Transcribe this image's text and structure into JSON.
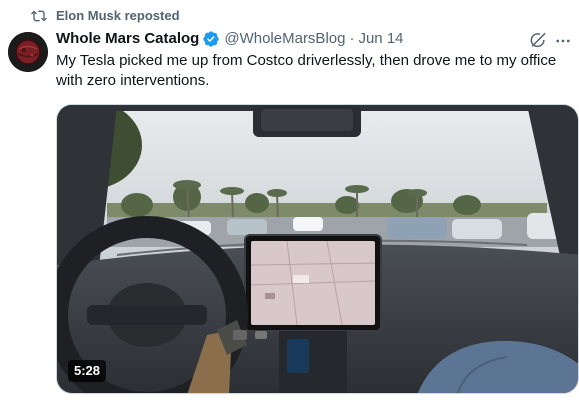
{
  "repost": {
    "label": "Elon Musk reposted",
    "icon": "repost-icon"
  },
  "author": {
    "display_name": "Whole Mars Catalog",
    "verified_icon": "verified-badge-icon",
    "handle": "@WholeMarsBlog",
    "separator": "·",
    "date": "Jun 14",
    "avatar_icon": "avatar"
  },
  "actions": {
    "grok_icon": "grok-icon",
    "more_icon": "more-icon"
  },
  "tweet": {
    "text": "My Tesla picked me up from Costco driverlessly, then drove me to my office with zero interventions."
  },
  "media": {
    "duration": "5:28"
  },
  "colors": {
    "accent": "#1d9bf0",
    "secondary_text": "#536471",
    "primary_text": "#0f1419"
  }
}
